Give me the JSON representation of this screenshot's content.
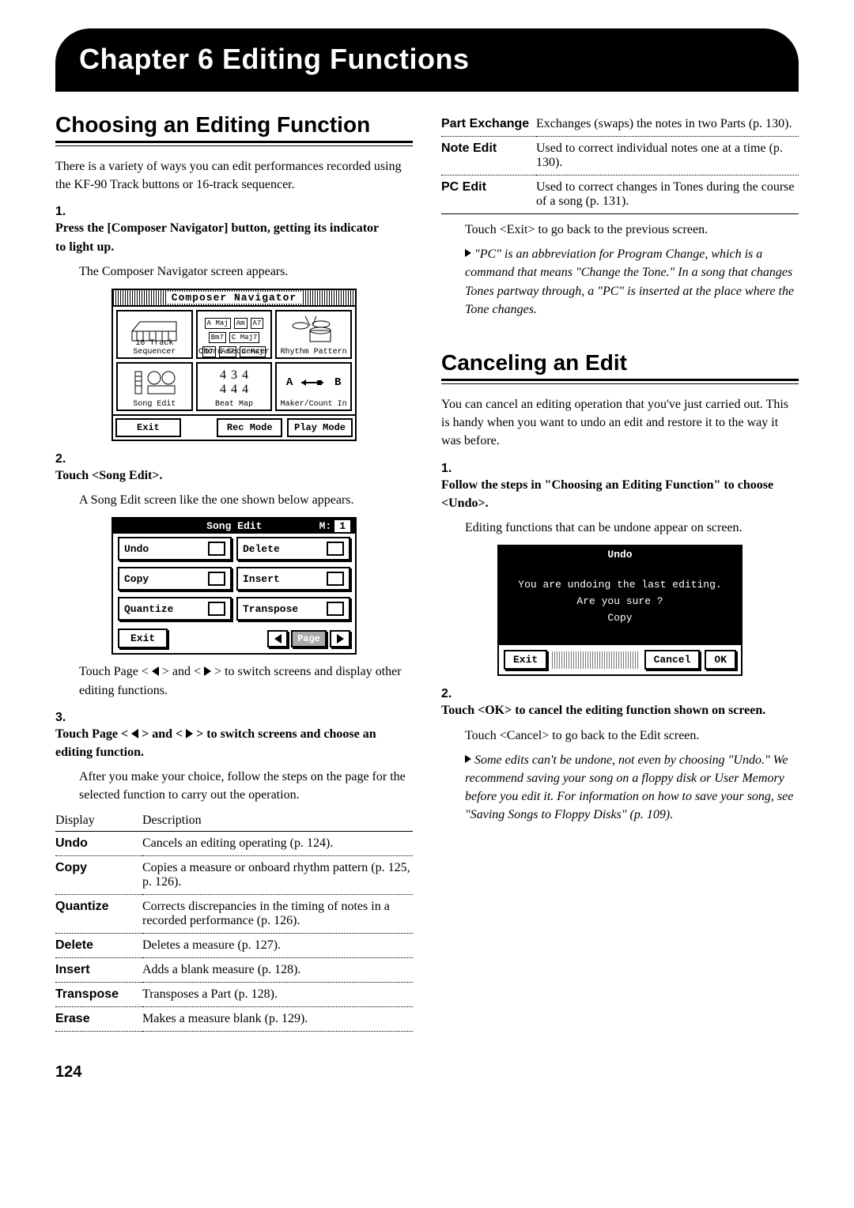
{
  "chapter_title": "Chapter 6 Editing Functions",
  "page_number": "124",
  "left": {
    "h1": "Choosing an Editing Function",
    "intro": "There is a variety of ways you can edit performances recorded using the KF-90 Track buttons or 16-track sequencer.",
    "step1_num": "1.",
    "step1_head": "Press the [Composer Navigator] button, getting its indicator to light up.",
    "step1_body": "The Composer Navigator screen appears.",
    "lcd1": {
      "title": "Composer Navigator",
      "cells": [
        "16 Track Sequencer",
        "Chord Sequencer",
        "Rhythm Pattern",
        "Song Edit",
        "Beat Map",
        "Maker/Count In"
      ],
      "chords": [
        "A Maj",
        "Am",
        "A7",
        "Bm7",
        "C Maj7",
        "D7",
        "Am7",
        "C Maj"
      ],
      "foot": [
        "Exit",
        "Rec Mode",
        "Play Mode"
      ]
    },
    "step2_num": "2.",
    "step2_head": "Touch <Song Edit>.",
    "step2_body": "A Song Edit screen like the one shown below appears.",
    "lcd2": {
      "title_left": "Song Edit",
      "title_right_m": "M:",
      "title_right_n": "1",
      "btns": [
        "Undo",
        "Delete",
        "Copy",
        "Insert",
        "Quantize",
        "Transpose"
      ],
      "exit": "Exit",
      "page": "Page"
    },
    "step2_after": "Touch Page < ◀ > and < ▶ > to switch screens and display other editing functions.",
    "step3_num": "3.",
    "step3_head_a": "Touch Page < ",
    "step3_head_b": " > and < ",
    "step3_head_c": " > to switch screens and choose an editing function.",
    "step3_body": "After you make your choice, follow the steps on the page for the selected function to carry out the operation.",
    "table": {
      "h1": "Display",
      "h2": "Description",
      "rows": [
        {
          "t": "Undo",
          "d": "Cancels an editing operating (p. 124)."
        },
        {
          "t": "Copy",
          "d": "Copies a measure or onboard rhythm pattern (p. 125, p. 126)."
        },
        {
          "t": "Quantize",
          "d": "Corrects discrepancies in the timing of notes in a recorded performance (p. 126)."
        },
        {
          "t": "Delete",
          "d": "Deletes a measure (p. 127)."
        },
        {
          "t": "Insert",
          "d": "Adds a blank measure (p. 128)."
        },
        {
          "t": "Transpose",
          "d": "Transposes a Part (p. 128)."
        },
        {
          "t": "Erase",
          "d": "Makes a measure blank (p. 129)."
        }
      ]
    }
  },
  "right": {
    "table2": {
      "rows": [
        {
          "t": "Part Exchange",
          "d": "Exchanges (swaps) the notes in two Parts (p. 130)."
        },
        {
          "t": "Note Edit",
          "d": "Used to correct individual notes one at a time (p. 130)."
        },
        {
          "t": "PC Edit",
          "d": "Used to correct changes in Tones during the course of a song (p. 131)."
        }
      ]
    },
    "exit_note": "Touch <Exit> to go back to the previous screen.",
    "pc_note": "\"PC\" is an abbreviation for Program Change, which is a command that means \"Change the Tone.\" In a song that changes Tones partway through, a \"PC\" is inserted at the place where the Tone changes.",
    "h2": "Canceling an Edit",
    "intro2": "You can cancel an editing operation that you've just carried out. This is handy when you want to undo an edit and restore it to the way it was before.",
    "step1_num": "1.",
    "step1_head": "Follow the steps in \"Choosing an Editing Function\" to choose <Undo>.",
    "step1_body": "Editing functions that can be undone appear on screen.",
    "lcd3": {
      "title": "Undo",
      "line1": "You are undoing the last editing.",
      "line2": "Are you sure ?",
      "line3": "Copy",
      "exit": "Exit",
      "cancel": "Cancel",
      "ok": "OK"
    },
    "step2_num": "2.",
    "step2_head": "Touch <OK> to cancel the editing function shown on screen.",
    "step2_body": "Touch <Cancel> to go back to the Edit screen.",
    "undo_note": "Some edits can't be undone, not even by choosing \"Undo.\" We recommend saving your song on a floppy disk or User Memory before you edit it. For information on how to save your song, see \"Saving Songs to Floppy Disks\" (p. 109)."
  }
}
